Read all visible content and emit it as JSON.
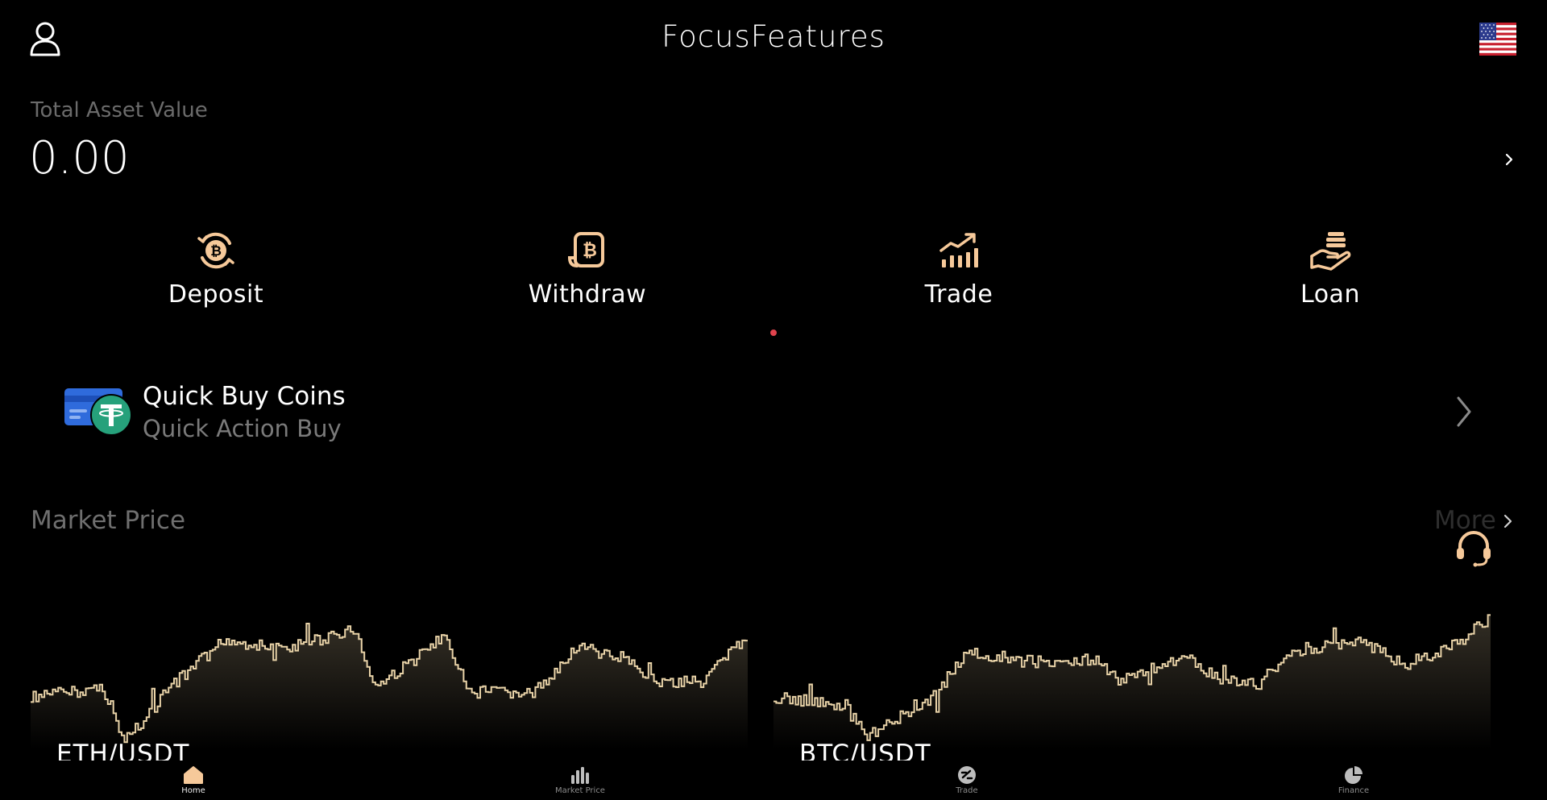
{
  "header": {
    "title": "FocusFeatures",
    "user_icon": "user-icon",
    "flag_icon": "us-flag-icon"
  },
  "asset": {
    "label": "Total Asset Value",
    "value": "0.00"
  },
  "actions": [
    {
      "label": "Deposit",
      "icon": "bitcoin-cycle-icon"
    },
    {
      "label": "Withdraw",
      "icon": "bitcoin-receipt-icon"
    },
    {
      "label": "Trade",
      "icon": "trend-up-icon"
    },
    {
      "label": "Loan",
      "icon": "hand-coins-icon"
    }
  ],
  "quick_buy": {
    "title": "Quick Buy Coins",
    "subtitle": "Quick Action Buy",
    "icon": "tether-card-icon"
  },
  "market": {
    "title": "Market Price",
    "more_label": "More",
    "pairs": [
      {
        "name": "ETH/USDT"
      },
      {
        "name": "BTC/USDT"
      }
    ]
  },
  "nav": [
    {
      "label": "Home",
      "icon": "home-icon",
      "active": true
    },
    {
      "label": "Market Price",
      "icon": "bar-chart-icon",
      "active": false
    },
    {
      "label": "Trade",
      "icon": "trade-icon",
      "active": false
    },
    {
      "label": "Finance",
      "icon": "pie-chart-icon",
      "active": false
    }
  ],
  "colors": {
    "accent": "#f6c99a",
    "chart_line": "#e9d3a8",
    "dot": "#e0434d",
    "tether": "#26a17b",
    "card": "#2f6bdc"
  }
}
